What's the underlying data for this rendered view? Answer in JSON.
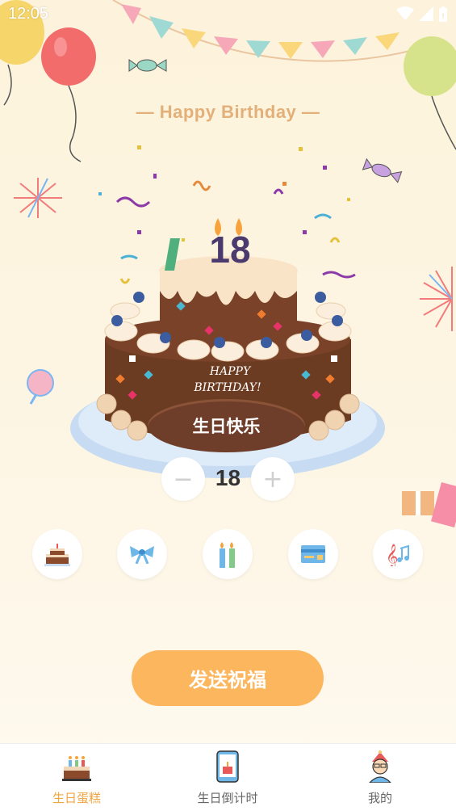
{
  "status_bar": {
    "time": "12:05"
  },
  "header": {
    "greeting": "— Happy Birthday —"
  },
  "cake": {
    "candle_number": "18",
    "plate_text": "生日快乐",
    "decoration_text_line1": "HAPPY",
    "decoration_text_line2": "BIRTHDAY!"
  },
  "counter": {
    "minus_label": "−",
    "value": "18",
    "plus_label": "+"
  },
  "tools": [
    {
      "icon": "cake-icon"
    },
    {
      "icon": "bow-icon"
    },
    {
      "icon": "candles-icon"
    },
    {
      "icon": "card-icon"
    },
    {
      "icon": "music-icon"
    }
  ],
  "send_button": {
    "label": "发送祝福"
  },
  "bottom_nav": {
    "items": [
      {
        "label": "生日蛋糕",
        "icon": "cake-icon",
        "active": true
      },
      {
        "label": "生日倒计时",
        "icon": "phone-cake-icon",
        "active": false
      },
      {
        "label": "我的",
        "icon": "avatar-icon",
        "active": false
      }
    ]
  },
  "colors": {
    "accent": "#fcb65e",
    "active_nav": "#f0a641",
    "background": "#fdf3dc",
    "title": "#e3b07a"
  }
}
